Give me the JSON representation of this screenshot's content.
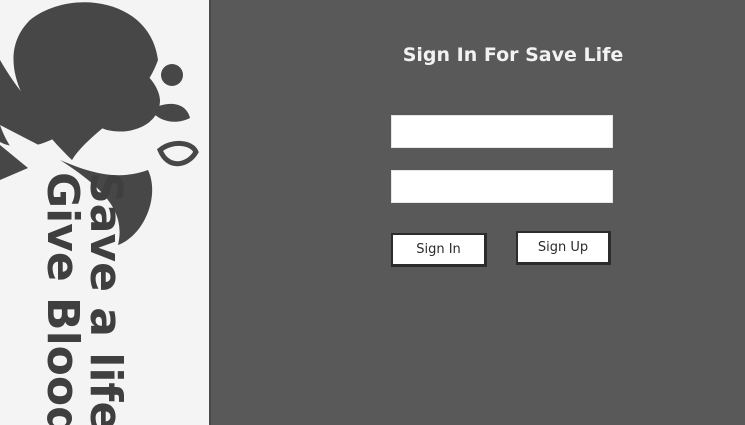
{
  "brand": {
    "logo_icon": "blood-drop-heart-logo",
    "tagline_line_1": "Save a life",
    "tagline_line_2": "Give Blood"
  },
  "form": {
    "title": "Sign In For Save Life",
    "username": {
      "value": "",
      "placeholder": ""
    },
    "password": {
      "value": "",
      "placeholder": ""
    },
    "sign_in_label": "Sign In",
    "sign_up_label": "Sign Up"
  },
  "colors": {
    "form_background": "#595959",
    "brand_background": "#f4f4f4",
    "logo": "#474747",
    "text_light": "#f2f2f2"
  }
}
